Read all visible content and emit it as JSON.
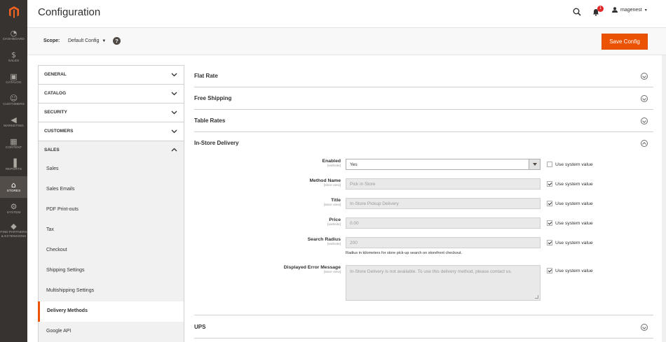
{
  "nav": {
    "items": [
      {
        "label": "DASHBOARD",
        "icon": "◔"
      },
      {
        "label": "SALES",
        "icon": "$"
      },
      {
        "label": "CATALOG",
        "icon": "▣"
      },
      {
        "label": "CUSTOMERS",
        "icon": "☺"
      },
      {
        "label": "MARKETING",
        "icon": "◀"
      },
      {
        "label": "CONTENT",
        "icon": "▦"
      },
      {
        "label": "REPORTS",
        "icon": "▐"
      },
      {
        "label": "STORES",
        "icon": "⌂"
      },
      {
        "label": "SYSTEM",
        "icon": "⚙"
      },
      {
        "label": "FIND PARTNERS & EXTENSIONS",
        "icon": "◆"
      }
    ],
    "active_index": 7
  },
  "header": {
    "title": "Configuration",
    "notification_count": "1",
    "username": "magenest"
  },
  "scope": {
    "label": "Scope:",
    "value": "Default Config",
    "help": "?",
    "save_label": "Save Config"
  },
  "tabs": {
    "groups": [
      "GENERAL",
      "CATALOG",
      "SECURITY",
      "CUSTOMERS"
    ],
    "open_group": "SALES",
    "sub_items": [
      "Sales",
      "Sales Emails",
      "PDF Print-outs",
      "Tax",
      "Checkout",
      "Shipping Settings",
      "Multishipping Settings",
      "Delivery Methods",
      "Google API"
    ],
    "active_sub": "Delivery Methods"
  },
  "sections": {
    "flat_rate": "Flat Rate",
    "free_shipping": "Free Shipping",
    "table_rates": "Table Rates",
    "in_store": "In-Store Delivery",
    "ups": "UPS"
  },
  "fields": {
    "enabled": {
      "label": "Enabled",
      "scope": "[website]",
      "value": "Yes"
    },
    "method_name": {
      "label": "Method Name",
      "scope": "[store view]",
      "value": "Pick in Store"
    },
    "title": {
      "label": "Title",
      "scope": "[store view]",
      "value": "In-Store Pickup Delivery"
    },
    "price": {
      "label": "Price",
      "scope": "[website]",
      "value": "0.00"
    },
    "search_radius": {
      "label": "Search Radius",
      "scope": "[website]",
      "value": "200",
      "note": "Radius in kilometers for store pick-up search on storefront checkout."
    },
    "error_message": {
      "label": "Displayed Error Message",
      "scope": "[store view]",
      "value": "In-Store Delivery is not available. To use this delivery method, please contact us."
    },
    "use_system_value": "Use system value"
  },
  "colors": {
    "accent": "#eb5202",
    "nav_bg": "#373330",
    "badge": "#e22626"
  }
}
